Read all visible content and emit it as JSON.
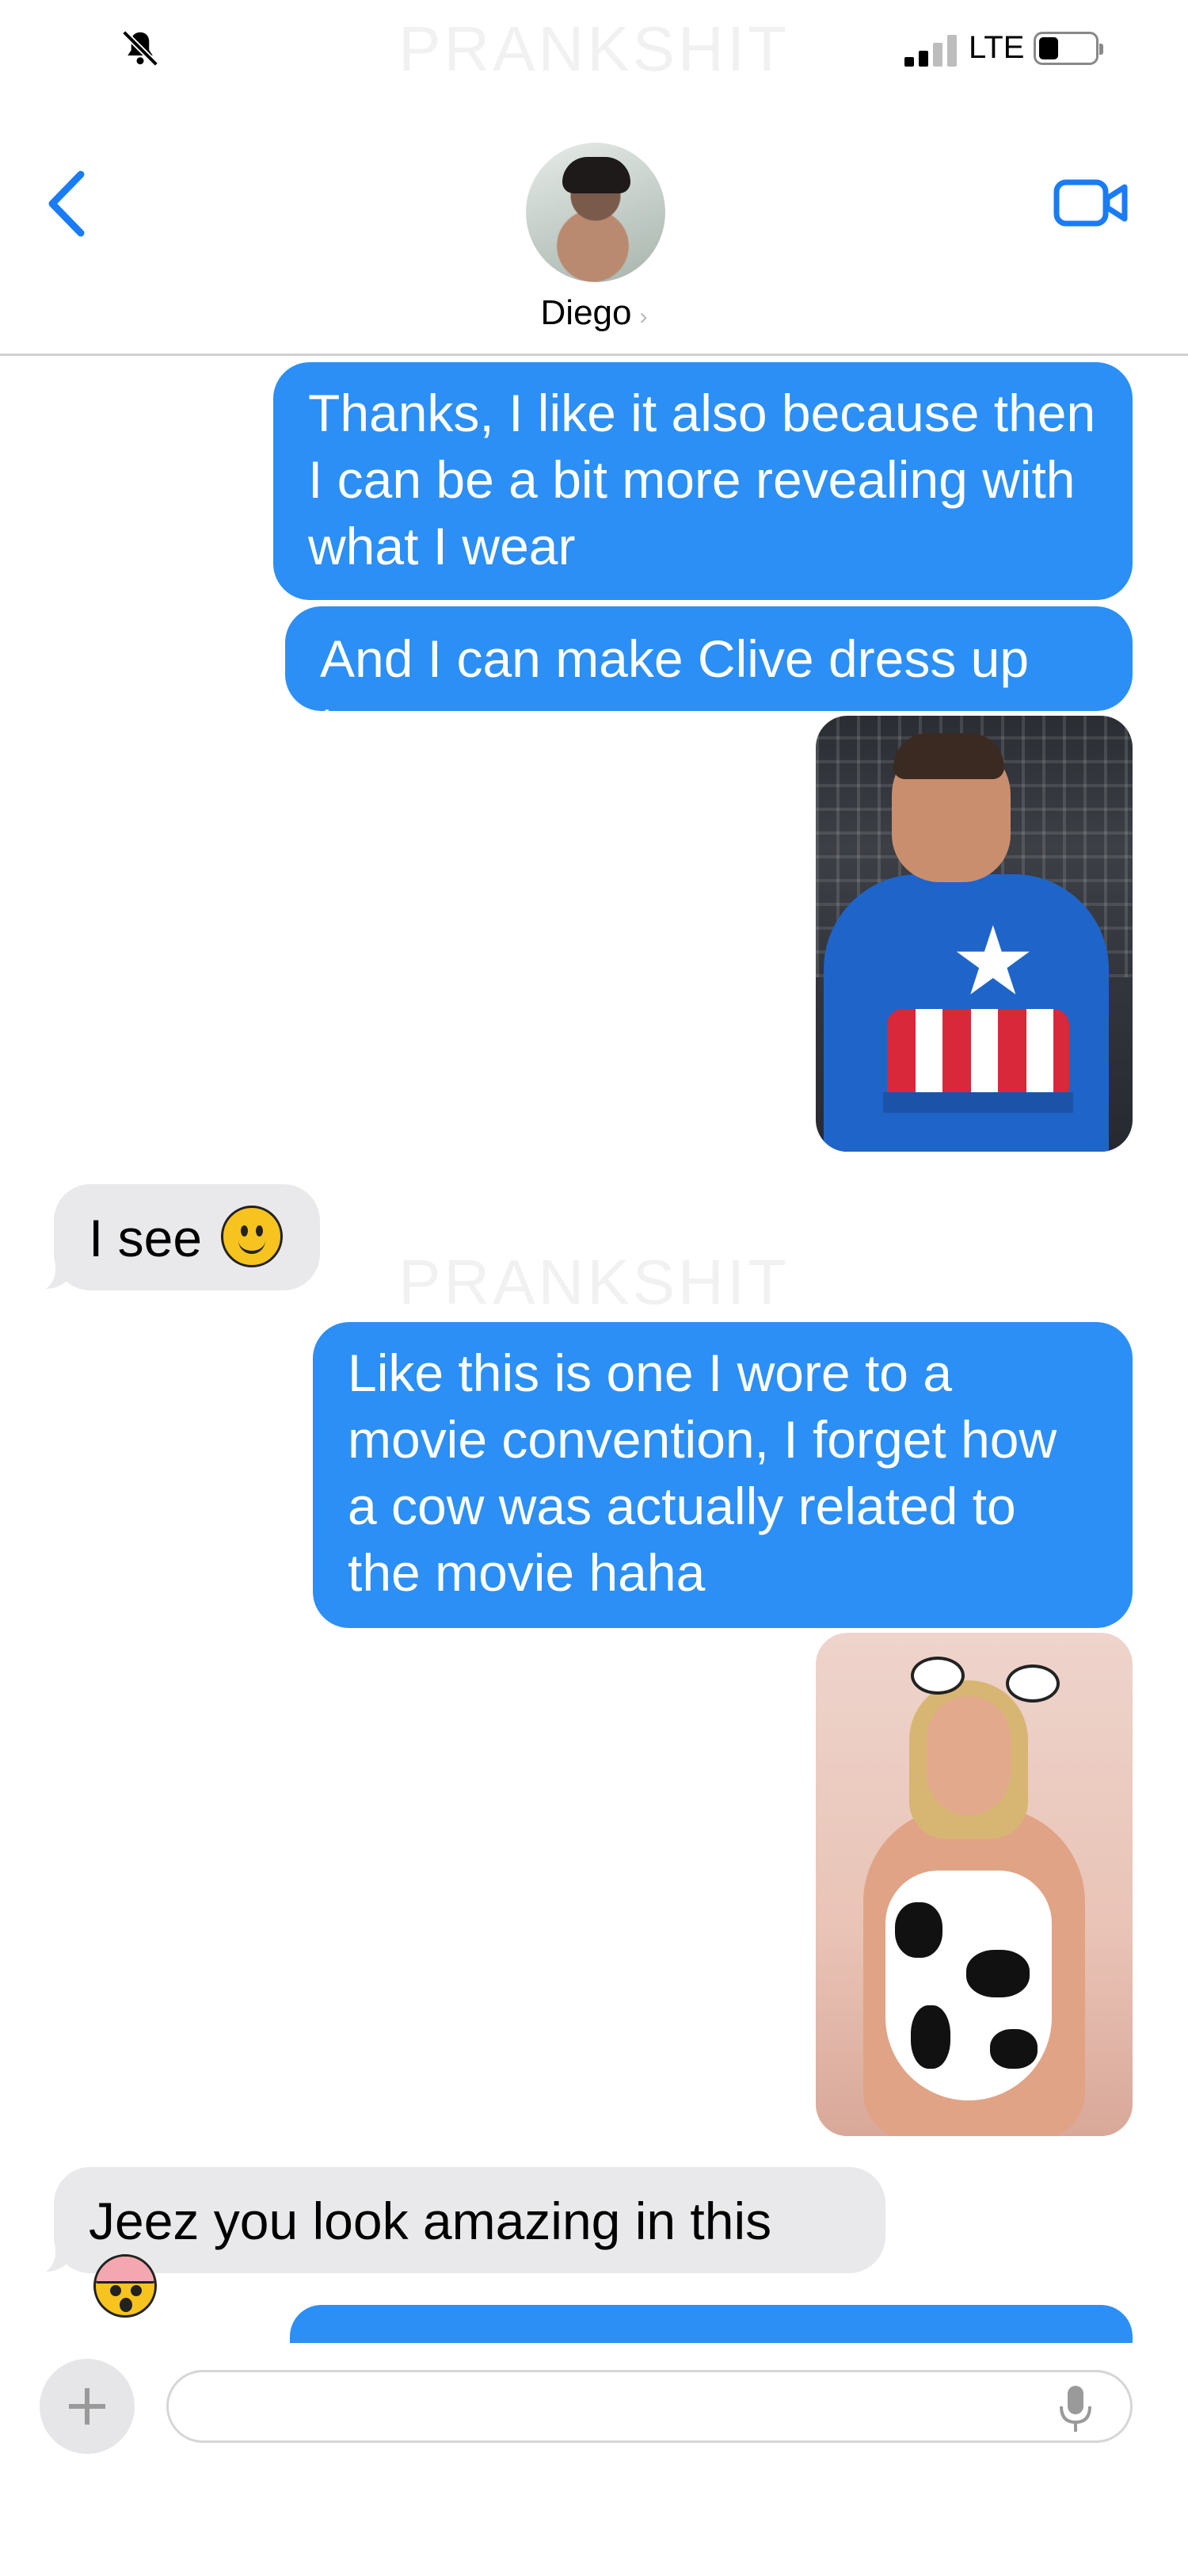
{
  "watermark": "PRANKSHIT",
  "status_bar": {
    "network": "LTE",
    "icons": [
      "bell-slash-icon",
      "signal-bars-icon",
      "battery-icon"
    ]
  },
  "header": {
    "back_icon": "chevron-left-icon",
    "contact_name": "Diego",
    "contact_chevron": "›",
    "video_icon": "video-camera-icon"
  },
  "messages": [
    {
      "type": "sent",
      "text": "Thanks, I like it also because then I can be a bit more revealing with what I wear"
    },
    {
      "type": "sent",
      "text": "And I can make Clive dress up too"
    },
    {
      "type": "sent-image",
      "subject": "captain-america-costume-photo"
    },
    {
      "type": "received",
      "text": "I see",
      "emoji": "smile-emoji"
    },
    {
      "type": "sent",
      "text": "Like this is one I wore to a movie convention, I forget how a cow was actually related to the movie haha"
    },
    {
      "type": "sent-image",
      "subject": "cow-costume-photo"
    },
    {
      "type": "received",
      "text": "Jeez you look amazing in this",
      "emoji": "shocked-brain-emoji"
    }
  ],
  "compose": {
    "input_value": "",
    "plus_icon": "plus-icon",
    "mic_icon": "microphone-icon"
  },
  "colors": {
    "sent_bubble": "#2b8ff5",
    "received_bubble": "#e9e9eb",
    "accent": "#1a7cf4"
  }
}
